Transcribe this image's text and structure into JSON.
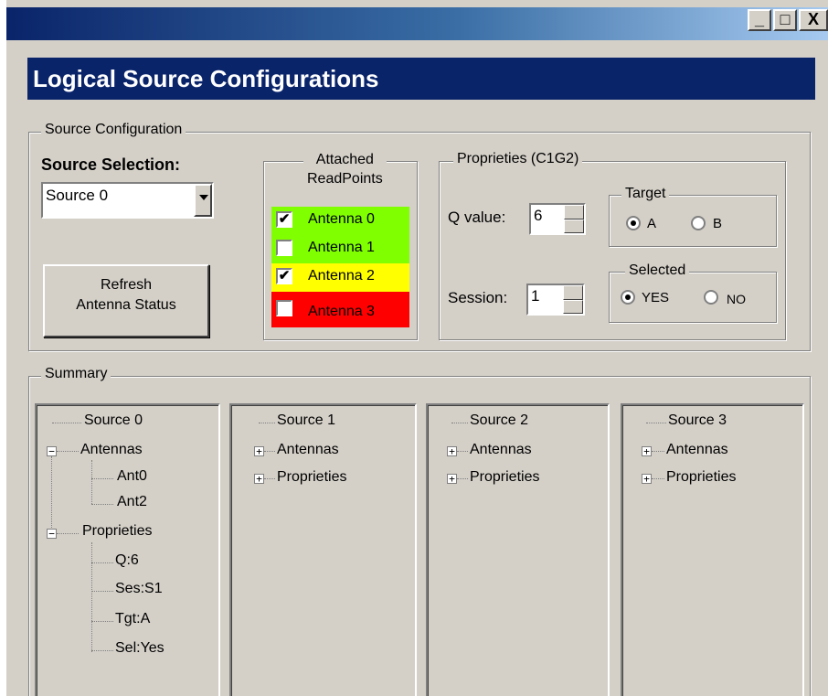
{
  "window": {
    "minimize": "_",
    "maximize": "□",
    "close": "X"
  },
  "banner": {
    "title": "Logical Source Configurations"
  },
  "source_config": {
    "legend": "Source Configuration",
    "selection_label": "Source Selection:",
    "selected_source": "Source 0",
    "refresh_button": [
      "Refresh",
      "Antenna Status"
    ],
    "readpoints": {
      "legend_line1": "Attached",
      "legend_line2": "ReadPoints",
      "antennas": [
        {
          "label": "Antenna 0",
          "checked": true,
          "status_color": "#80ff00"
        },
        {
          "label": "Antenna 1",
          "checked": false,
          "status_color": "#80ff00"
        },
        {
          "label": "Antenna 2",
          "checked": true,
          "status_color": "#ffff00"
        },
        {
          "label": "Antenna 3",
          "checked": false,
          "status_color": "#ff0000"
        }
      ]
    },
    "properties": {
      "legend": "Proprieties (C1G2)",
      "q_label": "Q value:",
      "q_value": "6",
      "session_label": "Session:",
      "session_value": "1",
      "target": {
        "legend": "Target",
        "a_label": "A",
        "b_label": "B",
        "selected": "A"
      },
      "selected": {
        "legend": "Selected",
        "yes_label": "YES",
        "no_label": "NO",
        "selected": "YES"
      }
    }
  },
  "summary": {
    "legend": "Summary",
    "sources": [
      {
        "name": "Source 0",
        "antennas_label": "Antennas",
        "antennas": [
          "Ant0",
          "Ant2"
        ],
        "properties_label": "Proprieties",
        "properties": [
          "Q:6",
          "Ses:S1",
          "Tgt:A",
          "Sel:Yes"
        ]
      },
      {
        "name": "Source 1",
        "antennas_label": "Antennas",
        "properties_label": "Proprieties"
      },
      {
        "name": "Source 2",
        "antennas_label": "Antennas",
        "properties_label": "Proprieties"
      },
      {
        "name": "Source 3",
        "antennas_label": "Antennas",
        "properties_label": "Proprieties"
      }
    ]
  },
  "colors": {
    "title_bar": "#0a246a",
    "face": "#d4d0c8",
    "green": "#80ff00",
    "yellow": "#ffff00",
    "red": "#ff0000"
  }
}
